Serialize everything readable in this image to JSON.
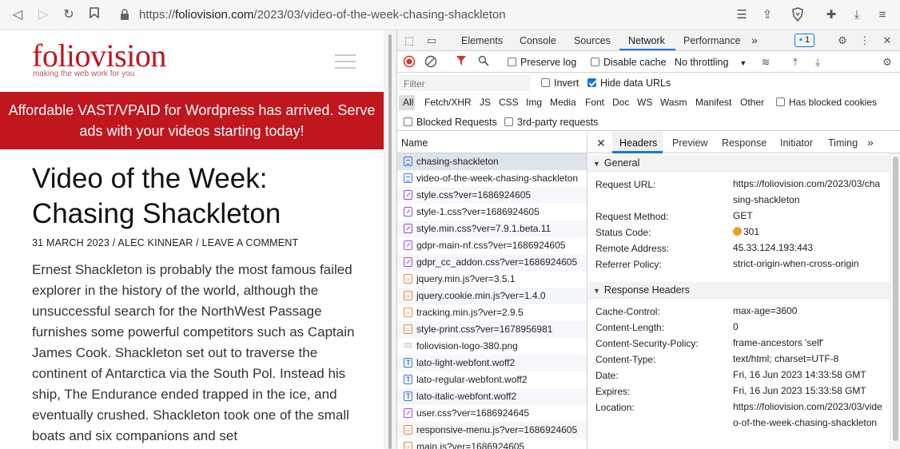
{
  "browser": {
    "url_prefix": "https://",
    "url_host": "foliovision.com",
    "url_path": "/2023/03/video-of-the-week-chasing-shackleton"
  },
  "site": {
    "logo": "foliovision",
    "tagline": "making the web work for you",
    "banner": "Affordable VAST/VPAID for Wordpress has arrived. Serve ads with your videos starting today!",
    "title_line1": "Video of the Week:",
    "title_line2": "Chasing Shackleton",
    "meta": "31 MARCH 2023 / ALEC KINNEAR / LEAVE A COMMENT",
    "body": "Ernest Shackleton is probably the most famous failed explorer in the history of the world, although the unsuccessful search for the NorthWest Passage furnishes some powerful competitors such as Captain James Cook. Shackleton set out to traverse the continent of Antarctica via the South Pol. Instead his ship, The Endurance ended trapped in the ice, and eventually crushed. Shackleton took one of the small boats and six companions and set"
  },
  "devtools": {
    "tabs": [
      "Elements",
      "Console",
      "Sources",
      "Network",
      "Performance"
    ],
    "more_tabs": "»",
    "issues_count": "1",
    "toolbar": {
      "preserve_log": "Preserve log",
      "disable_cache": "Disable cache",
      "throttling": "No throttling"
    },
    "filter": {
      "placeholder": "Filter",
      "invert": "Invert",
      "hide_data_urls": "Hide data URLs"
    },
    "types": [
      "All",
      "Fetch/XHR",
      "JS",
      "CSS",
      "Img",
      "Media",
      "Font",
      "Doc",
      "WS",
      "Wasm",
      "Manifest",
      "Other"
    ],
    "has_blocked_cookies": "Has blocked cookies",
    "blocked_requests": "Blocked Requests",
    "third_party": "3rd-party requests",
    "list_header": "Name",
    "requests": [
      {
        "name": "chasing-shackleton",
        "type": "doc"
      },
      {
        "name": "video-of-the-week-chasing-shackleton",
        "type": "doc"
      },
      {
        "name": "style.css?ver=1686924605",
        "type": "css"
      },
      {
        "name": "style-1.css?ver=1686924605",
        "type": "css"
      },
      {
        "name": "style.min.css?ver=7.9.1.beta.11",
        "type": "css"
      },
      {
        "name": "gdpr-main-nf.css?ver=1686924605",
        "type": "css"
      },
      {
        "name": "gdpr_cc_addon.css?ver=1686924605",
        "type": "css"
      },
      {
        "name": "jquery.min.js?ver=3.5.1",
        "type": "js"
      },
      {
        "name": "jquery.cookie.min.js?ver=1.4.0",
        "type": "js"
      },
      {
        "name": "tracking.min.js?ver=2.9.5",
        "type": "js"
      },
      {
        "name": "style-print.css?ver=1678956981",
        "type": "js"
      },
      {
        "name": "foliovision-logo-380.png",
        "type": "img"
      },
      {
        "name": "lato-light-webfont.woff2",
        "type": "font"
      },
      {
        "name": "lato-regular-webfont.woff2",
        "type": "font"
      },
      {
        "name": "lato-italic-webfont.woff2",
        "type": "font"
      },
      {
        "name": "user.css?ver=1686924645",
        "type": "css"
      },
      {
        "name": "responsive-menu.js?ver=1686924605",
        "type": "js"
      },
      {
        "name": "main.js?ver=1686924605",
        "type": "js"
      }
    ],
    "detail_tabs": [
      "Headers",
      "Preview",
      "Response",
      "Initiator",
      "Timing"
    ],
    "general_title": "General",
    "general": {
      "request_url_key": "Request URL:",
      "request_url_val": "https://foliovision.com/2023/03/chasing-shackleton",
      "method_key": "Request Method:",
      "method_val": "GET",
      "status_key": "Status Code:",
      "status_val": "301",
      "remote_key": "Remote Address:",
      "remote_val": "45.33.124.193:443",
      "referrer_key": "Referrer Policy:",
      "referrer_val": "strict-origin-when-cross-origin"
    },
    "response_title": "Response Headers",
    "response": {
      "cache_key": "Cache-Control:",
      "cache_val": "max-age=3600",
      "length_key": "Content-Length:",
      "length_val": "0",
      "csp_key": "Content-Security-Policy:",
      "csp_val": "frame-ancestors 'self'",
      "ctype_key": "Content-Type:",
      "ctype_val": "text/html; charset=UTF-8",
      "date_key": "Date:",
      "date_val": "Fri, 16 Jun 2023 14:33:58 GMT",
      "expires_key": "Expires:",
      "expires_val": "Fri, 16 Jun 2023 15:33:58 GMT",
      "location_key": "Location:",
      "location_val": "https://foliovision.com/2023/03/video-of-the-week-chasing-shackleton"
    }
  },
  "colors": {
    "brand": "#c0161d",
    "accent": "#1a73e8",
    "status_301": "#e6a024"
  }
}
